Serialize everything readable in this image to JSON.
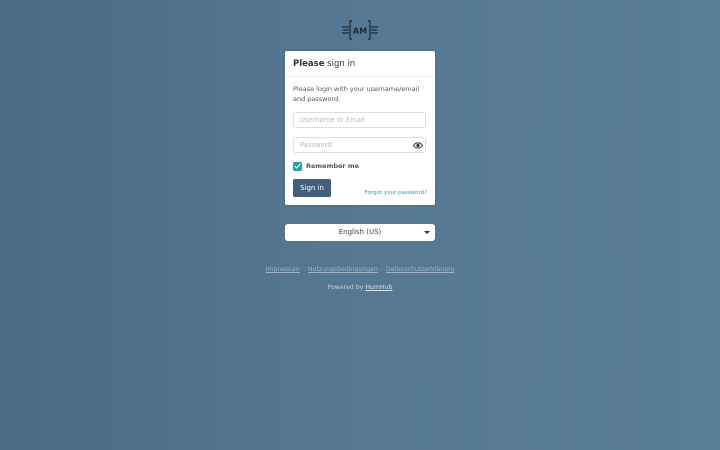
{
  "logo": {
    "text": "AM",
    "icon": "logo-icon"
  },
  "login": {
    "title_bold": "Please",
    "title_rest": "sign in",
    "intro": "Please login with your username/email and password.",
    "username": {
      "placeholder": "Username or Email",
      "value": ""
    },
    "password": {
      "placeholder": "Password",
      "value": "",
      "icon": "eye-icon"
    },
    "remember": {
      "label": "Remember me",
      "checked": true
    },
    "signin_label": "Sign in",
    "forgot_label": "Forgot your password?"
  },
  "language": {
    "selected": "English (US)"
  },
  "footer": {
    "links": [
      "Impressum",
      "Nutzungsbedingungen",
      "Datenschutzerklärung"
    ],
    "separator": "·",
    "powered_prefix": "Powered by",
    "powered_link": "HumHub"
  },
  "colors": {
    "accent": "#21a1b3",
    "primary": "#435f7a"
  }
}
